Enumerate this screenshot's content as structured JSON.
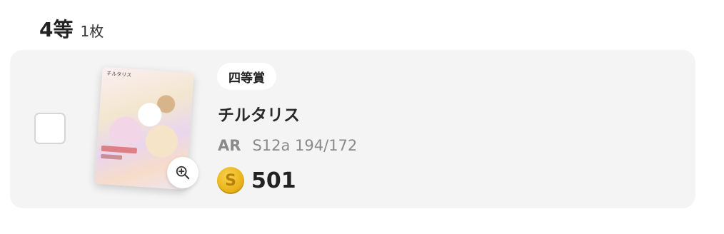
{
  "header": {
    "rank": "4等",
    "count": "1枚"
  },
  "prize": {
    "badge": "四等賞",
    "name": "チルタリス",
    "rarity": "AR",
    "set_number": "S12a 194/172",
    "coin_value": "501",
    "card_mini_title": "チルタリス",
    "selected": false
  },
  "colors": {
    "card_bg": "#f4f4f4",
    "coin": "#e9b31c",
    "text_dark": "#222222",
    "text_muted": "#8a8a8a"
  },
  "icons": {
    "zoom": "zoom-in-icon",
    "coin": "coin-icon"
  }
}
